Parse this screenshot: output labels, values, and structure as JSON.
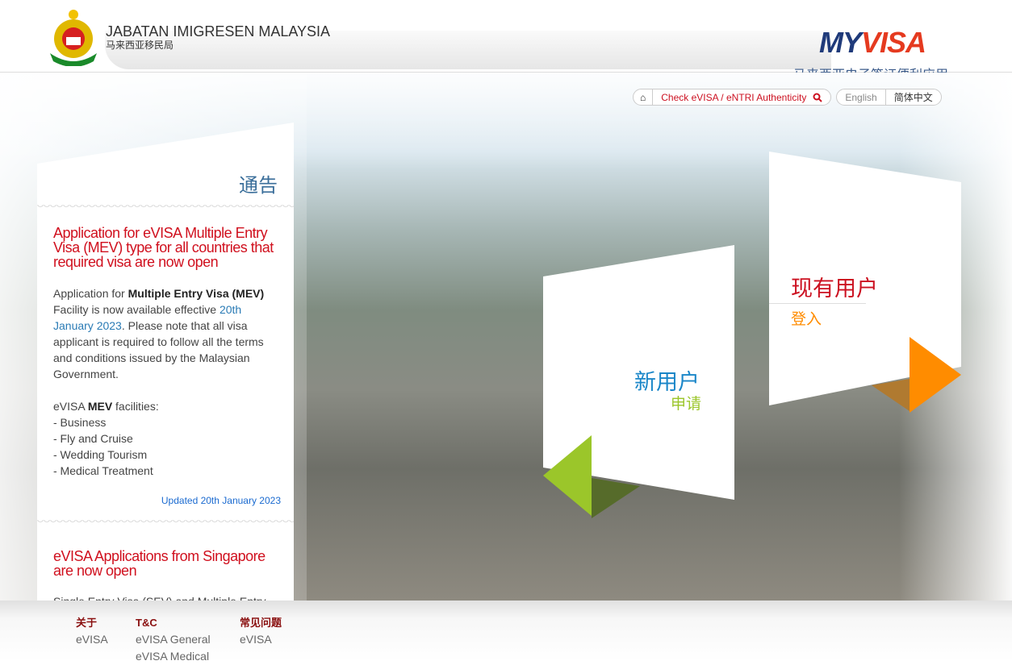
{
  "header": {
    "agency": "JABATAN IMIGRESEN MALAYSIA",
    "agency_cn": "马来西亚移民局",
    "logo_text": "MYVISA",
    "tagline": "马来西亚电子签证便利应用"
  },
  "nav": {
    "home_icon": "home-icon",
    "check": "Check eVISA / eNTRI Authenticity",
    "search_icon": "search-icon",
    "lang_en": "English",
    "lang_cn": "简体中文"
  },
  "notice": {
    "title": "通告",
    "items": [
      {
        "title": "Application for eVISA Multiple Entry Visa (MEV) type for all countries that required visa are now open",
        "p1a": "Application for ",
        "p1b": "Multiple Entry Visa (MEV)",
        "p1c": " Facility is now available effective ",
        "p1d": "20th January 2023",
        "p1e": ". Please note that all visa applicant is required to follow all the terms and conditions issued by the Malaysian Government.",
        "p2a": "eVISA ",
        "p2b": "MEV",
        "p2c": " facilities:",
        "list": [
          "- Business",
          "- Fly and Cruise",
          "- Wedding Tourism",
          "- Medical Treatment"
        ],
        "updated": "Updated 20th January 2023"
      },
      {
        "title": "eVISA Applications from Singapore are now open",
        "body": "Single Entry Visa (SEV) and Multiple Entry"
      }
    ]
  },
  "new_user": {
    "title": "新用户",
    "sub": "申请",
    "color": "#9bc62a"
  },
  "existing_user": {
    "title": "现有用户",
    "sub": "登入",
    "color": "#ff8c00"
  },
  "footer": {
    "cols": [
      {
        "head": "关于",
        "links": [
          "eVISA"
        ]
      },
      {
        "head": "T&C",
        "links": [
          "eVISA General",
          "eVISA Medical"
        ]
      },
      {
        "head": "常见问题",
        "links": [
          "eVISA"
        ]
      }
    ]
  }
}
